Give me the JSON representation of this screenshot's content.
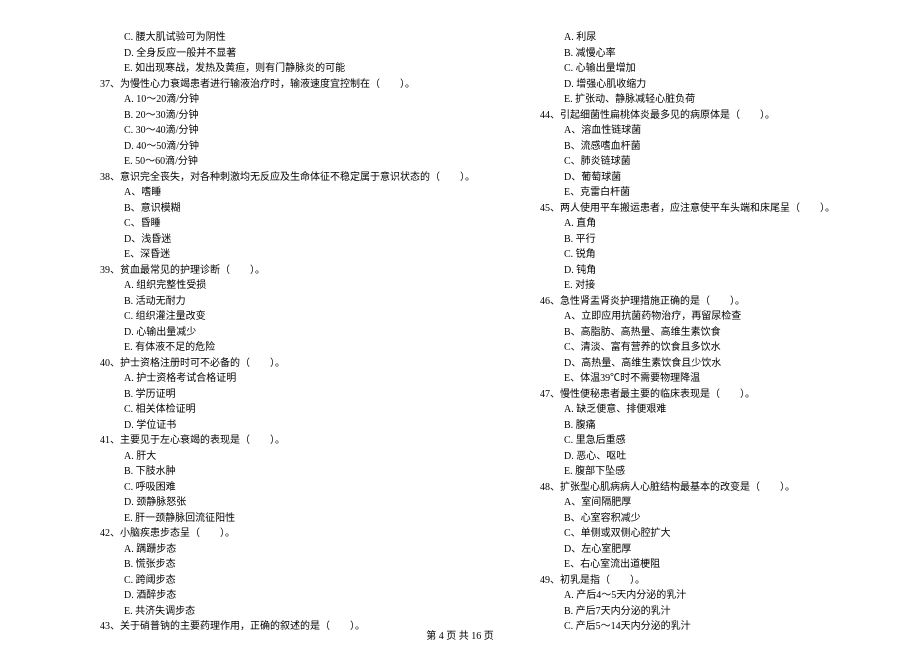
{
  "left": [
    {
      "cls": "opt",
      "t": "C. 腰大肌试验可为阴性"
    },
    {
      "cls": "opt",
      "t": "D. 全身反应一般并不显著"
    },
    {
      "cls": "opt",
      "t": "E. 如出现寒战，发热及黄疸，则有门静脉炎的可能"
    },
    {
      "cls": "q",
      "t": "37、为慢性心力衰竭患者进行输液治疗时，输液速度宜控制在（　　）。"
    },
    {
      "cls": "opt",
      "t": "A. 10～20滴/分钟"
    },
    {
      "cls": "opt",
      "t": "B. 20～30滴/分钟"
    },
    {
      "cls": "opt",
      "t": "C. 30～40滴/分钟"
    },
    {
      "cls": "opt",
      "t": "D. 40～50滴/分钟"
    },
    {
      "cls": "opt",
      "t": "E. 50～60滴/分钟"
    },
    {
      "cls": "q",
      "t": "38、意识完全丧失，对各种刺激均无反应及生命体征不稳定属于意识状态的（　　）。"
    },
    {
      "cls": "opt",
      "t": "A、嗜睡"
    },
    {
      "cls": "opt",
      "t": "B、意识模糊"
    },
    {
      "cls": "opt",
      "t": "C、昏睡"
    },
    {
      "cls": "opt",
      "t": "D、浅昏迷"
    },
    {
      "cls": "opt",
      "t": "E、深昏迷"
    },
    {
      "cls": "q",
      "t": "39、贫血最常见的护理诊断（　　）。"
    },
    {
      "cls": "opt",
      "t": "A. 组织完整性受损"
    },
    {
      "cls": "opt",
      "t": "B. 活动无耐力"
    },
    {
      "cls": "opt",
      "t": "C. 组织灌注量改变"
    },
    {
      "cls": "opt",
      "t": "D. 心输出量减少"
    },
    {
      "cls": "opt",
      "t": "E. 有体液不足的危险"
    },
    {
      "cls": "q",
      "t": "40、护士资格注册时可不必备的（　　）。"
    },
    {
      "cls": "opt",
      "t": "A. 护士资格考试合格证明"
    },
    {
      "cls": "opt",
      "t": "B. 学历证明"
    },
    {
      "cls": "opt",
      "t": "C. 相关体检证明"
    },
    {
      "cls": "opt",
      "t": "D. 学位证书"
    },
    {
      "cls": "q",
      "t": "41、主要见于左心衰竭的表现是（　　）。"
    },
    {
      "cls": "opt",
      "t": "A. 肝大"
    },
    {
      "cls": "opt",
      "t": "B. 下肢水肿"
    },
    {
      "cls": "opt",
      "t": "C. 呼吸困难"
    },
    {
      "cls": "opt",
      "t": "D. 颈静脉怒张"
    },
    {
      "cls": "opt",
      "t": "E. 肝一颈静脉回流征阳性"
    },
    {
      "cls": "q",
      "t": "42、小脑疾患步态呈（　　）。"
    },
    {
      "cls": "opt",
      "t": "A. 蹒跚步态"
    },
    {
      "cls": "opt",
      "t": "B. 慌张步态"
    },
    {
      "cls": "opt",
      "t": "C. 跨阈步态"
    },
    {
      "cls": "opt",
      "t": "D. 酒醉步态"
    },
    {
      "cls": "opt",
      "t": "E. 共济失调步态"
    },
    {
      "cls": "q",
      "t": "43、关于硝普钠的主要药理作用，正确的叙述的是（　　）。"
    }
  ],
  "right": [
    {
      "cls": "opt",
      "t": "A. 利尿"
    },
    {
      "cls": "opt",
      "t": "B. 减慢心率"
    },
    {
      "cls": "opt",
      "t": "C. 心输出量增加"
    },
    {
      "cls": "opt",
      "t": "D. 增强心肌收缩力"
    },
    {
      "cls": "opt",
      "t": "E. 扩张动、静脉减轻心脏负荷"
    },
    {
      "cls": "q",
      "t": "44、引起细菌性扁桃体炎最多见的病原体是（　　）。"
    },
    {
      "cls": "opt",
      "t": "A、溶血性链球菌"
    },
    {
      "cls": "opt",
      "t": "B、流感嗜血杆菌"
    },
    {
      "cls": "opt",
      "t": "C、肺炎链球菌"
    },
    {
      "cls": "opt",
      "t": "D、葡萄球菌"
    },
    {
      "cls": "opt",
      "t": "E、克雷白杆菌"
    },
    {
      "cls": "q",
      "t": "45、两人使用平车搬运患者，应注意使平车头端和床尾呈（　　）。"
    },
    {
      "cls": "opt",
      "t": "A. 直角"
    },
    {
      "cls": "opt",
      "t": "B. 平行"
    },
    {
      "cls": "opt",
      "t": "C. 锐角"
    },
    {
      "cls": "opt",
      "t": "D. 钝角"
    },
    {
      "cls": "opt",
      "t": "E. 对接"
    },
    {
      "cls": "q",
      "t": "46、急性肾盂肾炎护理措施正确的是（　　）。"
    },
    {
      "cls": "opt",
      "t": "A、立即应用抗菌药物治疗，再留尿检查"
    },
    {
      "cls": "opt",
      "t": "B、高脂肪、高热量、高维生素饮食"
    },
    {
      "cls": "opt",
      "t": "C、清淡、富有营养的饮食且多饮水"
    },
    {
      "cls": "opt",
      "t": "D、高热量、高维生素饮食且少饮水"
    },
    {
      "cls": "opt",
      "t": "E、体温39℃时不需要物理降温"
    },
    {
      "cls": "q",
      "t": "47、慢性便秘患者最主要的临床表现是（　　）。"
    },
    {
      "cls": "opt",
      "t": "A. 缺乏便意、排便艰难"
    },
    {
      "cls": "opt",
      "t": "B. 腹痛"
    },
    {
      "cls": "opt",
      "t": "C. 里急后重感"
    },
    {
      "cls": "opt",
      "t": "D. 恶心、呕吐"
    },
    {
      "cls": "opt",
      "t": "E. 腹部下坠感"
    },
    {
      "cls": "q",
      "t": "48、扩张型心肌病病人心脏结构最基本的改变是（　　）。"
    },
    {
      "cls": "opt",
      "t": "A、室间隔肥厚"
    },
    {
      "cls": "opt",
      "t": "B、心室容积减少"
    },
    {
      "cls": "opt",
      "t": "C、单侧或双侧心腔扩大"
    },
    {
      "cls": "opt",
      "t": "D、左心室肥厚"
    },
    {
      "cls": "opt",
      "t": "E、右心室流出道梗阻"
    },
    {
      "cls": "q",
      "t": "49、初乳是指（　　）。"
    },
    {
      "cls": "opt",
      "t": "A. 产后4～5天内分泌的乳汁"
    },
    {
      "cls": "opt",
      "t": "B. 产后7天内分泌的乳汁"
    },
    {
      "cls": "opt",
      "t": "C. 产后5～14天内分泌的乳汁"
    }
  ],
  "footer": "第 4 页 共 16 页"
}
